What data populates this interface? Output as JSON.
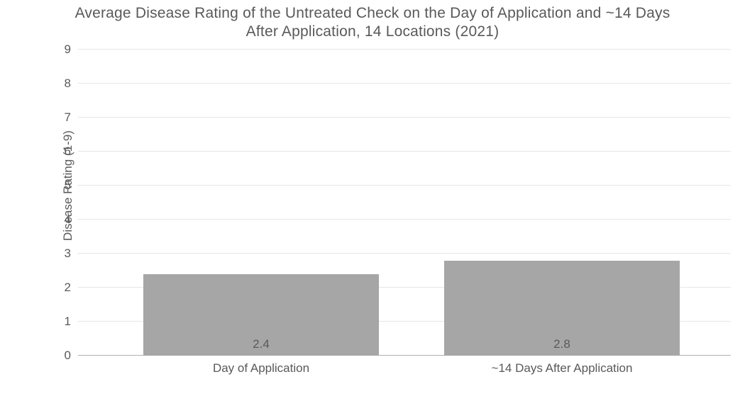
{
  "chart_data": {
    "type": "bar",
    "title": "Average Disease Rating of the Untreated Check on the Day of Application and ~14 Days After Application, 14 Locations (2021)",
    "title_line1": "Average Disease Rating of the Untreated Check on the Day of Application and ~14 Days",
    "title_line2": "After Application, 14 Locations (2021)",
    "ylabel": "Disease Rating (1-9)",
    "xlabel": "",
    "categories": [
      "Day of Application",
      "~14 Days After Application"
    ],
    "values": [
      2.4,
      2.8
    ],
    "value_labels": [
      "2.4",
      "2.8"
    ],
    "ylim": [
      0,
      9
    ],
    "yticks": [
      0,
      1,
      2,
      3,
      4,
      5,
      6,
      7,
      8,
      9
    ],
    "bar_color": "#a6a6a6",
    "grid_color": "#e6e6e6"
  }
}
